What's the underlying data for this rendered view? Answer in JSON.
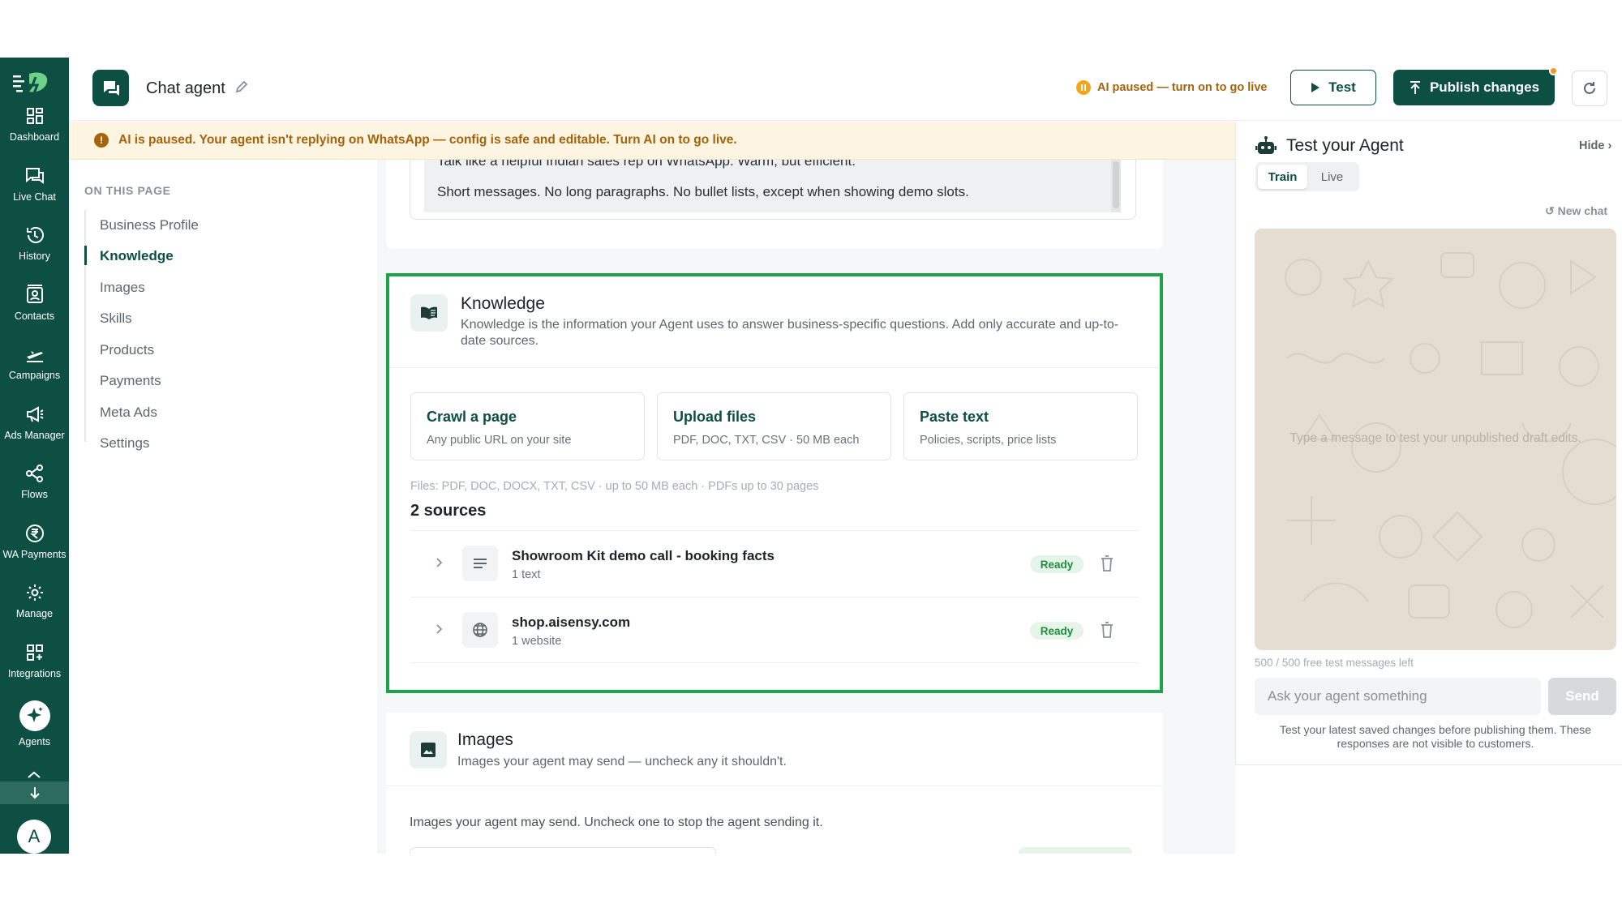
{
  "rail": {
    "items": [
      {
        "label": "Dashboard",
        "icon": "dashboard-icon"
      },
      {
        "label": "Live Chat",
        "icon": "live-chat-icon"
      },
      {
        "label": "History",
        "icon": "history-icon"
      },
      {
        "label": "Contacts",
        "icon": "contacts-icon"
      },
      {
        "label": "Campaigns",
        "icon": "campaigns-icon"
      },
      {
        "label": "Ads Manager",
        "icon": "megaphone-icon"
      },
      {
        "label": "Flows",
        "icon": "flows-icon"
      },
      {
        "label": "WA Payments",
        "icon": "rupee-icon"
      },
      {
        "label": "Manage",
        "icon": "gear-icon"
      },
      {
        "label": "Integrations",
        "icon": "integrations-icon"
      },
      {
        "label": "Agents",
        "icon": "sparkle-icon"
      }
    ],
    "avatar_letter": "A"
  },
  "header": {
    "title": "Chat agent",
    "status": "AI paused — turn on to go live",
    "test_label": "Test",
    "publish_label": "Publish changes"
  },
  "banner": {
    "text": "AI is paused. Your agent isn't replying on WhatsApp — config is safe and editable. Turn AI on to go live."
  },
  "toc": {
    "heading": "ON THIS PAGE",
    "items": [
      "Business Profile",
      "Knowledge",
      "Images",
      "Skills",
      "Products",
      "Payments",
      "Meta Ads",
      "Settings"
    ],
    "active": "Knowledge"
  },
  "prompt": {
    "cut_line": "Talk like a helpful Indian sales rep on WhatsApp. Warm, but efficient.",
    "line": "Short messages. No long paragraphs. No bullet lists, except when showing demo slots."
  },
  "knowledge": {
    "title": "Knowledge",
    "description": "Knowledge is the information your Agent uses to answer business-specific questions. Add only accurate and up-to-date sources.",
    "options": [
      {
        "title": "Crawl a page",
        "sub": "Any public URL on your site"
      },
      {
        "title": "Upload files",
        "sub": "PDF, DOC, TXT, CSV · 50 MB each"
      },
      {
        "title": "Paste text",
        "sub": "Policies, scripts, price lists"
      }
    ],
    "files_note": "Files: PDF, DOC, DOCX, TXT, CSV · up to 50 MB each · PDFs up to 30 pages",
    "sources_count": "2 sources",
    "sources": [
      {
        "title": "Showroom Kit demo call - booking facts",
        "sub": "1 text",
        "status": "Ready",
        "icon": "text-lines-icon"
      },
      {
        "title": "shop.aisensy.com",
        "sub": "1 website",
        "status": "Ready",
        "icon": "globe-icon"
      }
    ]
  },
  "images": {
    "title": "Images",
    "description": "Images your agent may send — uncheck any it shouldn't.",
    "note": "Images your agent may send. Uncheck one to stop the agent sending it."
  },
  "panel": {
    "title": "Test your Agent",
    "hide": "Hide ›",
    "tabs": [
      "Train",
      "Live"
    ],
    "active_tab": "Train",
    "new_chat": "↺ New chat",
    "placeholder_msg": "Type a message to test your unpublished draft edits.",
    "msgs_left": "500 / 500 free test messages left",
    "input_placeholder": "Ask your agent something",
    "send": "Send",
    "footnote": "Test your latest saved changes before publishing them. These responses are not visible to customers."
  },
  "colors": {
    "brand": "#0d4f43",
    "highlight_border": "#1fa34a",
    "warning": "#a5630b",
    "banner_bg": "#fdf4e2"
  }
}
